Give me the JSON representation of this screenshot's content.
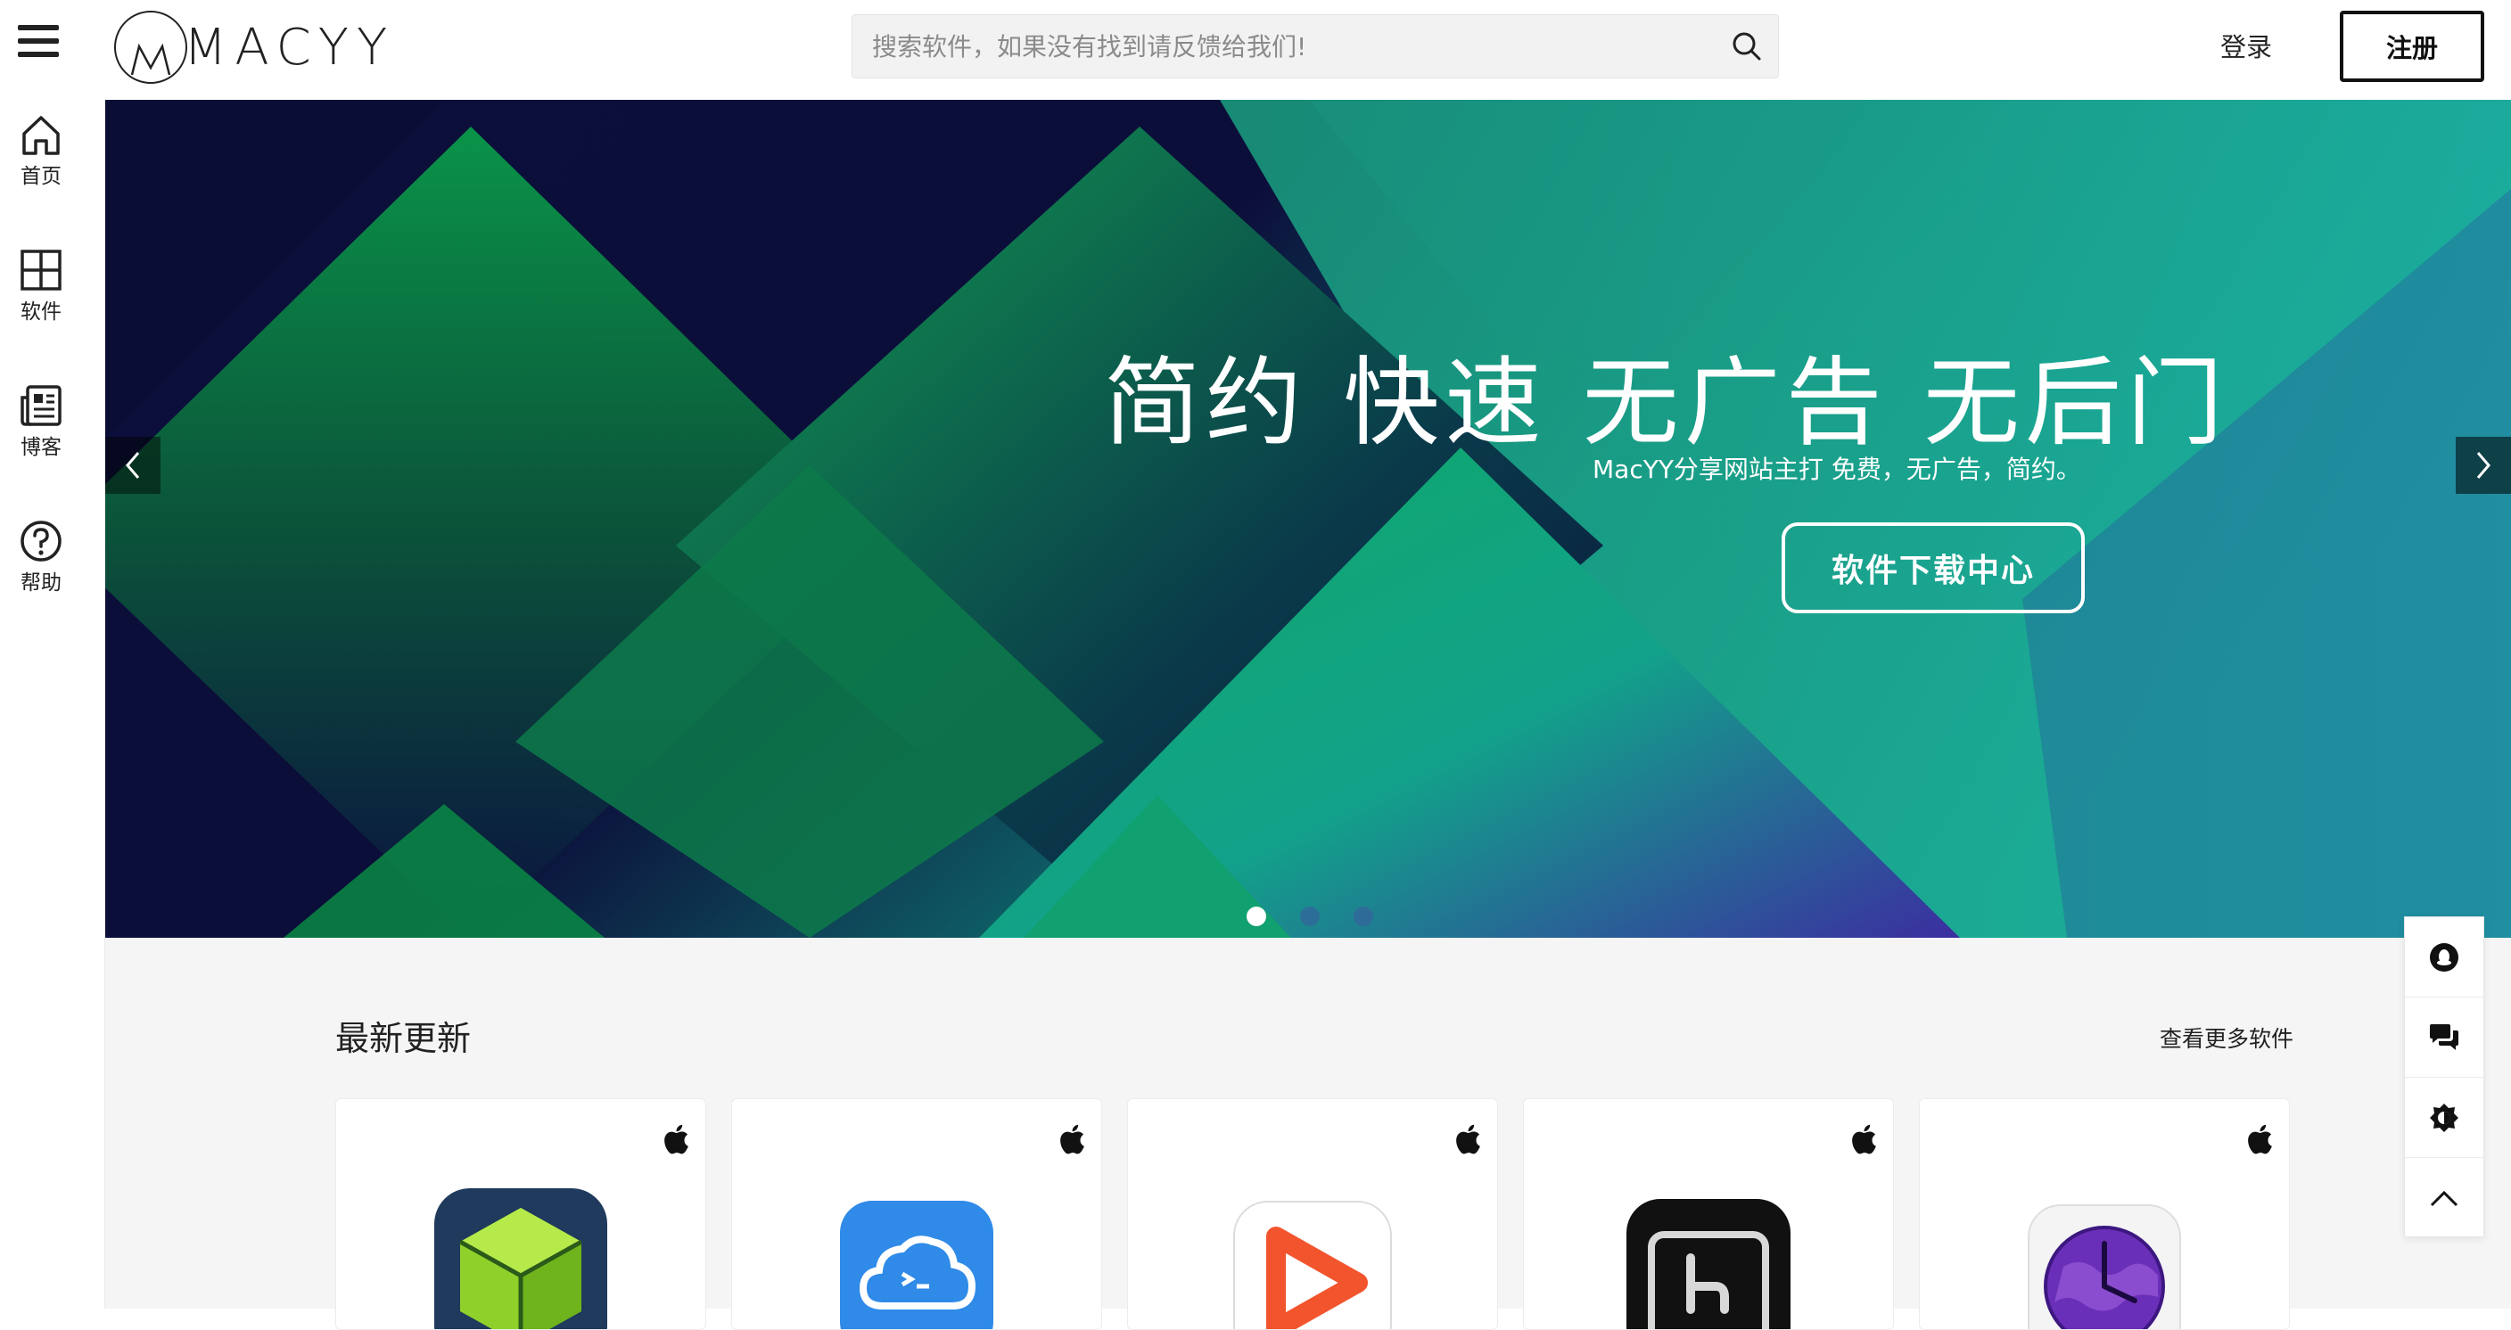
{
  "header": {
    "logo_text": "MACYY",
    "search_placeholder": "搜索软件，如果没有找到请反馈给我们!",
    "login_label": "登录",
    "register_label": "注册"
  },
  "sidebar": {
    "items": [
      {
        "label": "首页",
        "icon": "home-icon"
      },
      {
        "label": "软件",
        "icon": "grid-icon"
      },
      {
        "label": "博客",
        "icon": "blog-icon"
      },
      {
        "label": "帮助",
        "icon": "help-icon"
      }
    ]
  },
  "banner": {
    "headline": "简约 快速 无广告 无后门",
    "subline": "MacYY分享网站主打 免费，无广告，简约。",
    "cta_label": "软件下载中心",
    "slide_count": 3,
    "active_slide": 1
  },
  "section": {
    "title": "最新更新",
    "view_more": "查看更多软件"
  },
  "cards": [
    {
      "platform": "apple-icon",
      "app_icon": "green-cube-app-icon"
    },
    {
      "platform": "apple-icon",
      "app_icon": "blue-cloud-terminal-app-icon"
    },
    {
      "platform": "apple-icon",
      "app_icon": "orange-play-app-icon"
    },
    {
      "platform": "apple-icon",
      "app_icon": "black-hand-app-icon"
    },
    {
      "platform": "apple-icon",
      "app_icon": "purple-globe-clock-app-icon"
    }
  ],
  "floatbar": {
    "items": [
      "qq-icon",
      "chat-icon",
      "theme-toggle-icon",
      "back-to-top-icon"
    ]
  }
}
